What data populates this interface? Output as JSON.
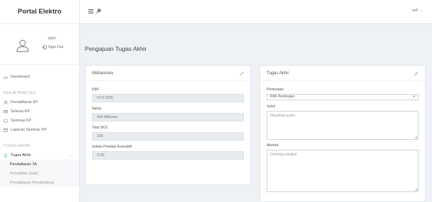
{
  "app": {
    "brand": "Portal Elektro"
  },
  "user": {
    "name": "ARIF",
    "sign_out": "Sign Out"
  },
  "topbar": {
    "user_label": "arif"
  },
  "sidebar": {
    "dashboard": "Dashboard",
    "kp_header": "KERJA PRAKTEK",
    "kp_items": [
      "Pendaftaran KP",
      "Selesai KP",
      "Seminar KP",
      "Laporan Seminar KP"
    ],
    "ta_header": "TUGAS AKHIR",
    "ta_item": "Tugas Akhir",
    "ta_subitems": [
      "Pendaftaran TA",
      "Pendaftan Judul",
      "Pendaftaran Pembimbing"
    ]
  },
  "page": {
    "title": "Pengajuan Tugas Akhir"
  },
  "mahasiswa": {
    "title": "Mahasiswa",
    "nim_label": "NIM",
    "nim_value": "I0717005",
    "nama_label": "Nama",
    "nama_value": "Arif Wibowo",
    "sks_label": "Total SKS",
    "sks_value": "105",
    "ipk_label": "Indeks Prestasi Kumulatif",
    "ipk_value": "3.09"
  },
  "tugas_akhir": {
    "title": "Tugas Akhir",
    "peminatan_label": "Peminatan",
    "peminatan_value": "Pilih Peminatan",
    "judul_label": "Judul",
    "judul_placeholder": "Masukkan judul",
    "abstrak_label": "Abstrak",
    "abstrak_placeholder": "Deskripsi singkat"
  }
}
